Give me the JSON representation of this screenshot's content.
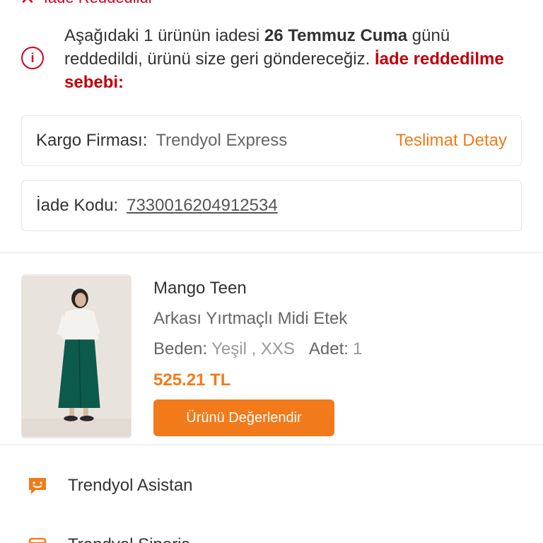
{
  "status": {
    "label": "İade Reddedildi"
  },
  "notice": {
    "text_1": "Aşağıdaki 1 ürünün iadesi ",
    "date": "26 Temmuz Cuma",
    "text_2": " günü reddedildi, ürünü size geri göndereceğiz. ",
    "reason_link": "İade reddedilme sebebi:"
  },
  "cargo": {
    "label": "Kargo Firması:",
    "value": "Trendyol Express",
    "link": "Teslimat Detay"
  },
  "return_code": {
    "label": "İade Kodu:",
    "value": "7330016204912534"
  },
  "product": {
    "brand": "Mango Teen",
    "name": "Arkası Yırtmaçlı Midi Etek",
    "size_label": "Beden:",
    "size_value": "Yeşil , XXS",
    "qty_label": "Adet:",
    "qty_value": "1",
    "price": "525.21 TL",
    "review_button": "Ürünü Değerlendir"
  },
  "menu": {
    "assistant": "Trendyol Asistan",
    "next": "Trendyol Sipariş"
  },
  "colors": {
    "accent": "#f27a1a",
    "error": "#d0021b"
  }
}
